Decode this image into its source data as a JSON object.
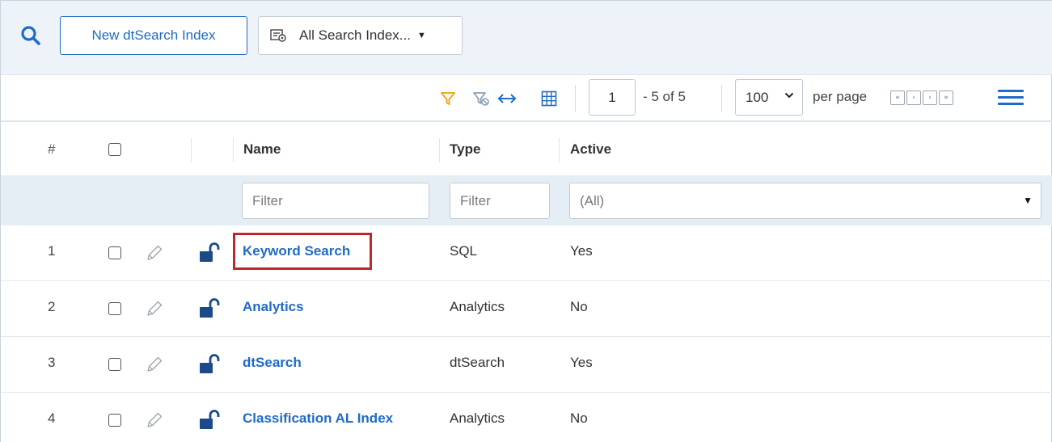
{
  "toolbar": {
    "search_icon": "search-icon",
    "new_index_label": "New dtSearch Index",
    "view_selector_label": "All Search Index...",
    "view_selector_icon": "view-list-icon"
  },
  "pager": {
    "current_page": "1",
    "of_text": "- 5  of  5",
    "per_page_value": "100",
    "per_page_label": "per page",
    "nav": [
      "«",
      "‹",
      "›",
      "»"
    ]
  },
  "columns": {
    "number": "#",
    "name": "Name",
    "type": "Type",
    "active": "Active"
  },
  "filters": {
    "name_placeholder": "Filter",
    "type_placeholder": "Filter",
    "active_value": "(All)"
  },
  "rows": [
    {
      "number": "1",
      "name": "Keyword Search",
      "type": "SQL",
      "active": "Yes"
    },
    {
      "number": "2",
      "name": "Analytics",
      "type": "Analytics",
      "active": "No"
    },
    {
      "number": "3",
      "name": "dtSearch",
      "type": "dtSearch",
      "active": "Yes"
    },
    {
      "number": "4",
      "name": "Classification AL Index",
      "type": "Analytics",
      "active": "No"
    }
  ],
  "colors": {
    "accent": "#1f6bc6",
    "filter_icon": "#f5a623",
    "highlight": "#c0272d"
  }
}
